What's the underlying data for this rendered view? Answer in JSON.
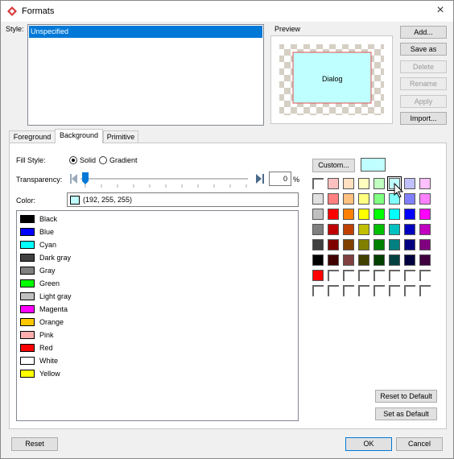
{
  "window": {
    "title": "Formats",
    "close": "×"
  },
  "style": {
    "label": "Style:",
    "items": [
      "Unspecified"
    ]
  },
  "preview": {
    "label": "Preview",
    "text": "Dialog"
  },
  "side_buttons": {
    "add": "Add...",
    "save_as": "Save as",
    "delete": "Delete",
    "rename": "Rename",
    "apply": "Apply",
    "import": "Import..."
  },
  "tabs": [
    "Foreground",
    "Background",
    "Primitive"
  ],
  "fill_style": {
    "label": "Fill Style:",
    "options": [
      "Solid",
      "Gradient"
    ],
    "selected": "Solid"
  },
  "transparency": {
    "label": "Transparency:",
    "value": "0",
    "unit": "%",
    "level": 0
  },
  "color": {
    "label": "Color:",
    "value": "(192, 255, 255)",
    "swatch": "#c0ffff"
  },
  "color_list": [
    {
      "name": "Black",
      "hex": "#000000"
    },
    {
      "name": "Blue",
      "hex": "#0000ff"
    },
    {
      "name": "Cyan",
      "hex": "#00ffff"
    },
    {
      "name": "Dark gray",
      "hex": "#404040"
    },
    {
      "name": "Gray",
      "hex": "#808080"
    },
    {
      "name": "Green",
      "hex": "#00ff00"
    },
    {
      "name": "Light gray",
      "hex": "#c0c0c0"
    },
    {
      "name": "Magenta",
      "hex": "#ff00ff"
    },
    {
      "name": "Orange",
      "hex": "#ffc800"
    },
    {
      "name": "Pink",
      "hex": "#ffafaf"
    },
    {
      "name": "Red",
      "hex": "#ff0000"
    },
    {
      "name": "White",
      "hex": "#ffffff"
    },
    {
      "name": "Yellow",
      "hex": "#ffff00"
    }
  ],
  "custom": {
    "label": "Custom...",
    "swatch": "#c0ffff"
  },
  "palette": [
    [
      "",
      "#ffc0c0",
      "#ffe0c0",
      "#ffffc0",
      "#c0ffc0",
      "#c0ffff",
      "#c0c0ff",
      "#ffc0ff"
    ],
    [
      "#e0e0e0",
      "#ff8080",
      "#ffc080",
      "#ffff80",
      "#80ff80",
      "#80ffff",
      "#8080ff",
      "#ff80ff"
    ],
    [
      "#c0c0c0",
      "#ff0000",
      "#ff8000",
      "#ffff00",
      "#00ff00",
      "#00ffff",
      "#0000ff",
      "#ff00ff"
    ],
    [
      "#808080",
      "#c00000",
      "#c04000",
      "#c0c000",
      "#00c000",
      "#00c0c0",
      "#0000c0",
      "#c000c0"
    ],
    [
      "#404040",
      "#800000",
      "#804000",
      "#808000",
      "#008000",
      "#008080",
      "#000080",
      "#800080"
    ],
    [
      "#000000",
      "#400000",
      "#804040",
      "#404000",
      "#004000",
      "#004040",
      "#000040",
      "#400040"
    ],
    [
      "#ff0000",
      "",
      "",
      "",
      "",
      "",
      "",
      ""
    ],
    [
      "",
      "",
      "",
      "",
      "",
      "",
      "",
      ""
    ]
  ],
  "selected_palette_cell": "row 0, col 5",
  "bottom_buttons": {
    "reset_default": "Reset to Default",
    "set_default": "Set as Default",
    "reset": "Reset",
    "ok": "OK",
    "cancel": "Cancel"
  }
}
